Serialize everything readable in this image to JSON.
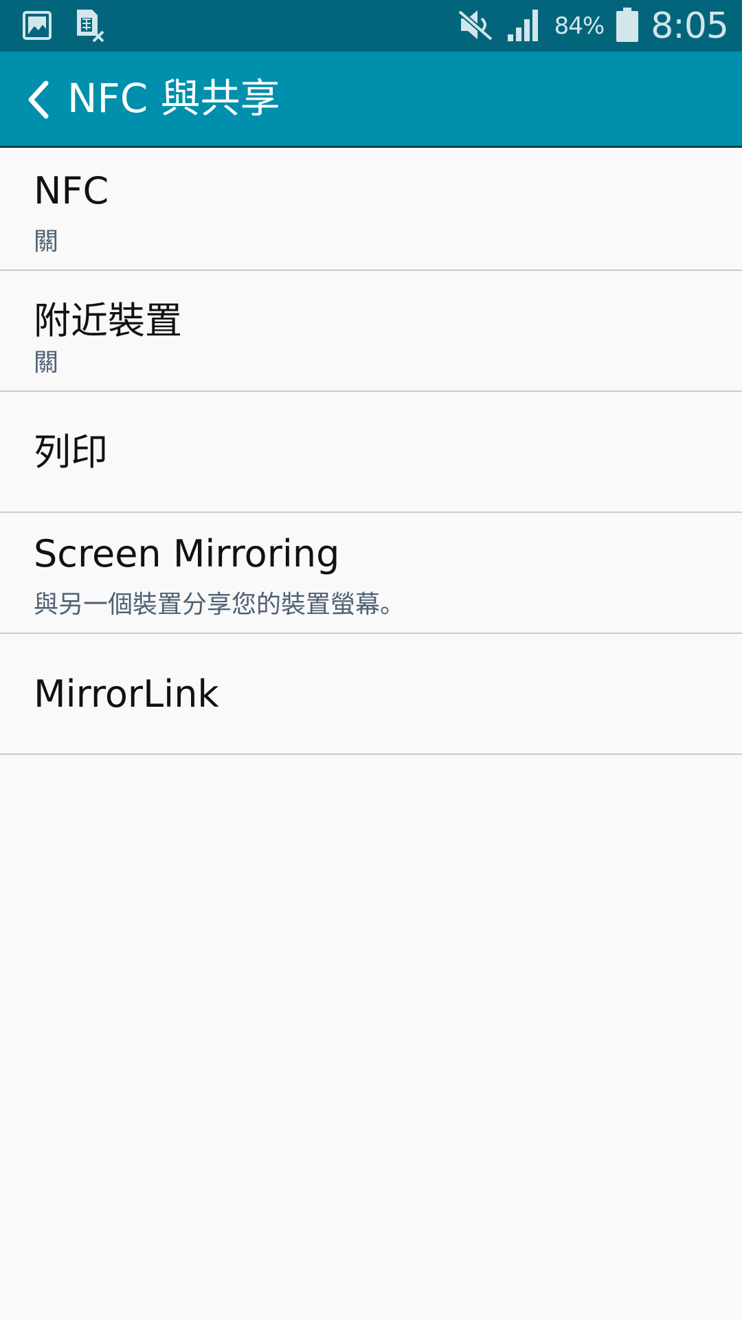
{
  "status_bar": {
    "left_icons": [
      "gallery-icon",
      "sim-card-error-icon"
    ],
    "right_icons": [
      "mute-icon",
      "signal-icon",
      "battery-icon"
    ],
    "battery_percent": "84%",
    "time": "8:05"
  },
  "app_bar": {
    "title": "NFC 與共享",
    "back_icon": "chevron-left-icon"
  },
  "settings": [
    {
      "title": "NFC",
      "subtitle": "關"
    },
    {
      "title": "附近裝置",
      "subtitle": "關"
    },
    {
      "title": "列印"
    },
    {
      "title": "Screen Mirroring",
      "subtitle": "與另一個裝置分享您的裝置螢幕。"
    },
    {
      "title": "MirrorLink"
    }
  ],
  "colors": {
    "status_bar": "#03657b",
    "app_bar": "#008fac",
    "background": "#f9f9fa",
    "divider": "#c6cbd3",
    "subtitle": "#4f6173"
  }
}
